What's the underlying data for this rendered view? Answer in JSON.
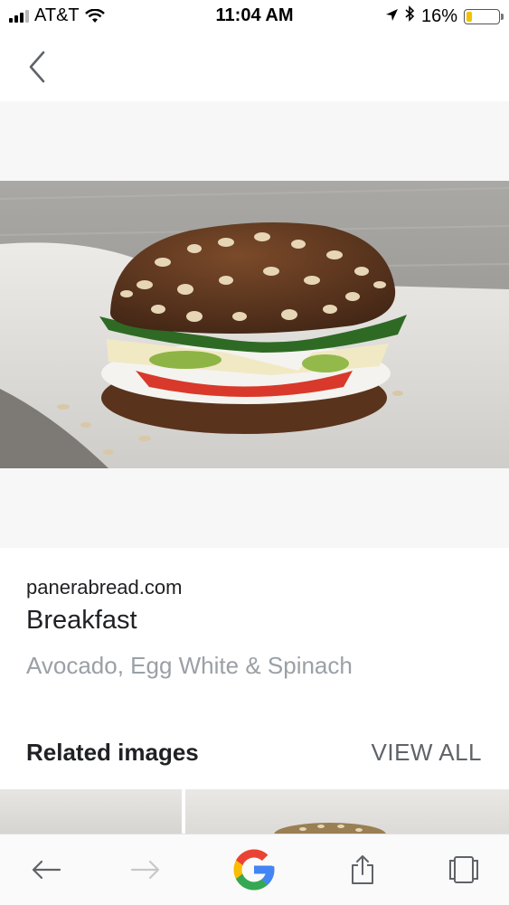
{
  "status_bar": {
    "carrier": "AT&T",
    "time": "11:04 AM",
    "battery_percent": "16%",
    "battery_level": 0.16,
    "battery_color": "#f2c200",
    "icons": [
      "signal-icon",
      "wifi-icon",
      "location-arrow-icon",
      "bluetooth-icon",
      "battery-icon"
    ]
  },
  "header": {
    "back_icon": "chevron-left-icon"
  },
  "result": {
    "source": "panerabread.com",
    "title": "Breakfast",
    "subtitle": "Avocado, Egg White & Spinach"
  },
  "related": {
    "heading": "Related images",
    "view_all_label": "VIEW ALL"
  },
  "toolbar": {
    "icons": [
      "back-arrow-icon",
      "forward-arrow-icon",
      "google-logo-icon",
      "share-icon",
      "tabs-icon"
    ],
    "google_colors": [
      "#4285F4",
      "#EA4335",
      "#FBBC05",
      "#34A853"
    ]
  }
}
